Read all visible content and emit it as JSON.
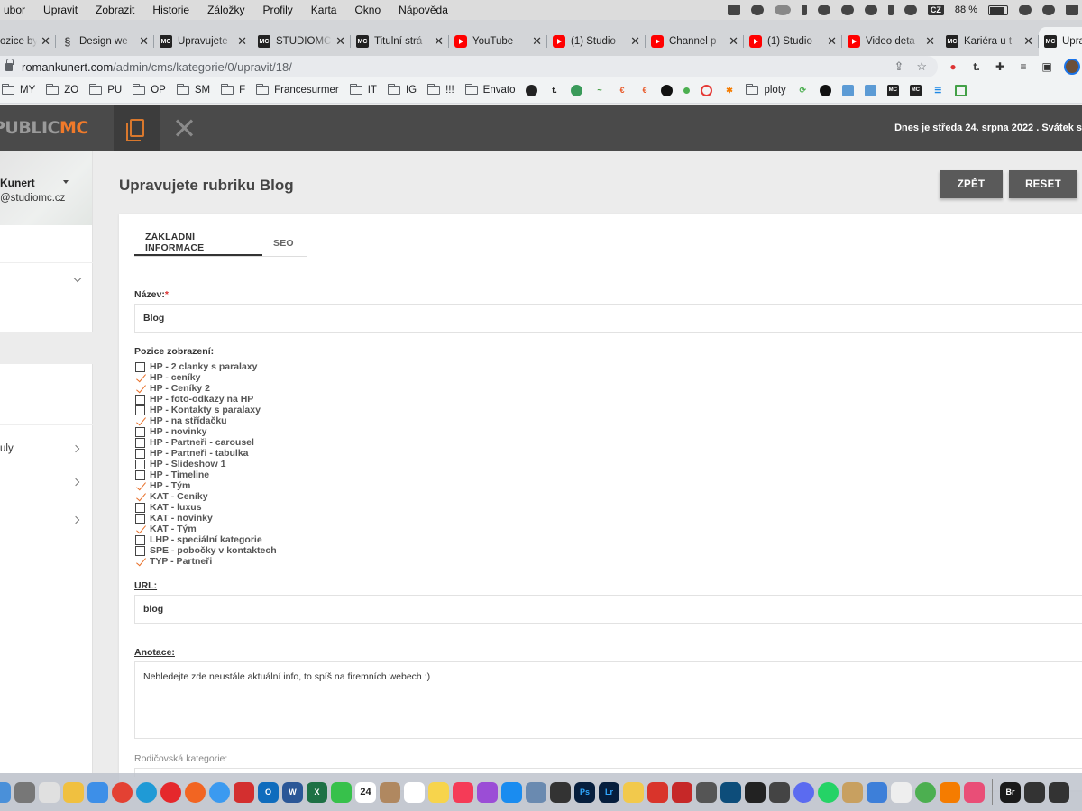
{
  "menubar": {
    "items": [
      "ubor",
      "Upravit",
      "Zobrazit",
      "Historie",
      "Záložky",
      "Profily",
      "Karta",
      "Okno",
      "Nápověda"
    ],
    "input_source": "CZ",
    "battery": "88 %"
  },
  "tabs": [
    {
      "title": "ozice by",
      "icon": "none"
    },
    {
      "title": "Design we",
      "icon": "swirl-icon"
    },
    {
      "title": "Upravujete",
      "icon": "mc-icon"
    },
    {
      "title": "STUDIOMC",
      "icon": "mc-icon"
    },
    {
      "title": "Titulní strá",
      "icon": "mc-icon"
    },
    {
      "title": "YouTube",
      "icon": "youtube-icon"
    },
    {
      "title": "(1) Studio",
      "icon": "youtube-icon"
    },
    {
      "title": "Channel p",
      "icon": "youtube-icon"
    },
    {
      "title": "(1) Studio",
      "icon": "youtube-icon"
    },
    {
      "title": "Video deta",
      "icon": "youtube-icon"
    },
    {
      "title": "Kariéra u t",
      "icon": "mc-icon"
    },
    {
      "title": "Upravuje",
      "icon": "mc-icon",
      "active": true
    }
  ],
  "address": {
    "domain": "romankunert.com",
    "path": "/admin/cms/kategorie/0/upravit/18/"
  },
  "bookmarks": {
    "folders": [
      "MY",
      "ZO",
      "PU",
      "OP",
      "SM",
      "F",
      "Francesurmer",
      "IT",
      "IG",
      "!!!",
      "Envato"
    ],
    "last_folder": "ploty"
  },
  "header": {
    "logo_part1": "PUBLIC",
    "logo_part2": "MC",
    "date_text": "Dnes je středa 24. srpna 2022 . Svátek s"
  },
  "sidebar": {
    "user_name": "Kunert",
    "user_email": "@studiomc.cz",
    "nav_label": "uly"
  },
  "page": {
    "title": "Upravujete rubriku Blog",
    "back_button": "ZPĚT",
    "reset_button": "RESET",
    "tab_basic": "ZÁKLADNÍ INFORMACE",
    "tab_seo": "SEO"
  },
  "form": {
    "name_label": "Název:",
    "name_required": "*",
    "name_value": "Blog",
    "positions_label": "Pozice zobrazení:",
    "positions": [
      {
        "label": "HP - 2 clanky s paralaxy",
        "checked": false
      },
      {
        "label": "HP - ceníky",
        "checked": true
      },
      {
        "label": "HP - Ceníky 2",
        "checked": true
      },
      {
        "label": "HP - foto-odkazy na HP",
        "checked": false
      },
      {
        "label": "HP - Kontakty s paralaxy",
        "checked": false
      },
      {
        "label": "HP - na střídačku",
        "checked": true
      },
      {
        "label": "HP - novinky",
        "checked": false
      },
      {
        "label": "HP - Partneři - carousel",
        "checked": false
      },
      {
        "label": "HP - Partneři - tabulka",
        "checked": false
      },
      {
        "label": "HP - Slideshow 1",
        "checked": false
      },
      {
        "label": "HP - Timeline",
        "checked": false
      },
      {
        "label": "HP - Tým",
        "checked": true
      },
      {
        "label": "KAT - Ceníky",
        "checked": true
      },
      {
        "label": "KAT - luxus",
        "checked": false
      },
      {
        "label": "KAT - novinky",
        "checked": false
      },
      {
        "label": "KAT - Tým",
        "checked": true
      },
      {
        "label": "LHP - speciální kategorie",
        "checked": false
      },
      {
        "label": "SPE - pobočky v kontaktech",
        "checked": false
      },
      {
        "label": "TYP - Partneři",
        "checked": true
      }
    ],
    "url_label": "URL:",
    "url_value": "blog",
    "annotation_label": "Anotace:",
    "annotation_value": "Nehledejte zde neustále aktuální info, to spíš na firemních webech :)",
    "parent_label": "Rodičovská kategorie:"
  },
  "dock": {
    "calendar_day": "24",
    "apps": [
      "Ps",
      "Lr",
      "Br"
    ]
  },
  "colors": {
    "accent": "#f07a2a",
    "header_bg": "#4a4a4a",
    "button_bg": "#5a5a5a"
  }
}
